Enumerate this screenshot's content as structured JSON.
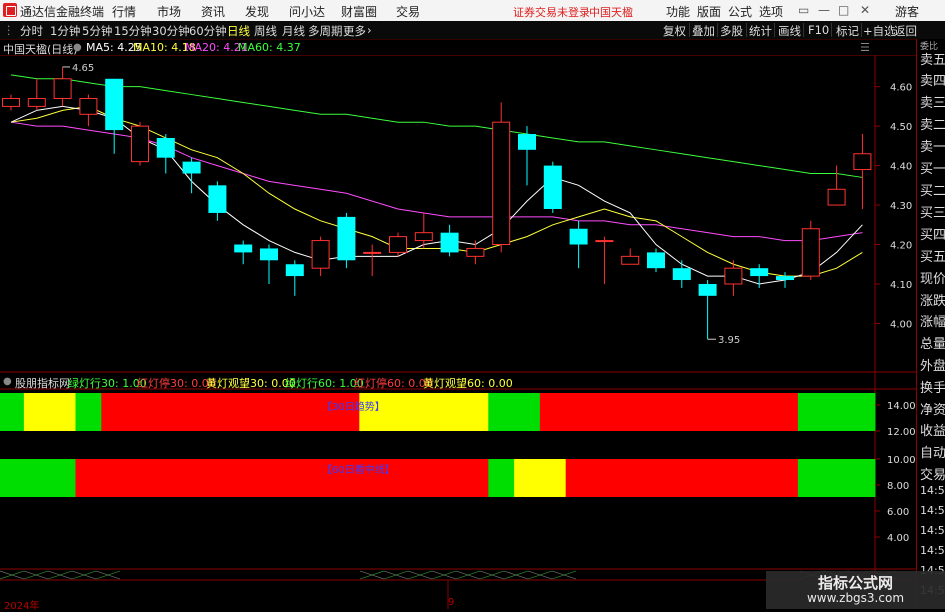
{
  "menubar": {
    "app_title": "通达信金融终端",
    "menus": [
      "行情",
      "市场",
      "资讯",
      "发现",
      "问小达",
      "财富圈",
      "交易"
    ],
    "status": "证券交易未登录",
    "stock_name": "中国天楹",
    "right_menus": [
      "功能",
      "版面",
      "公式",
      "选项"
    ],
    "window_controls": [
      "▭",
      "—",
      "□",
      "✕"
    ],
    "guest": "游客"
  },
  "toolbar": {
    "periods": [
      "分时",
      "1分钟",
      "5分钟",
      "15分钟",
      "30分钟",
      "60分钟",
      "日线",
      "周线",
      "月线",
      "多周期",
      "更多"
    ],
    "selected_period": "日线",
    "more_arrow": "›",
    "buttons": [
      "复权",
      "叠加",
      "多股",
      "统计",
      "画线",
      "F10",
      "标记",
      "+自选",
      "返回"
    ]
  },
  "main_chart": {
    "title": "中国天楹(日线)",
    "ma_labels": [
      {
        "text": "MA5: 4.25",
        "color": "#ffffff"
      },
      {
        "text": "MA10: 4.18",
        "color": "#ffff3c"
      },
      {
        "text": "MA20: 4.21",
        "color": "#ff4cff"
      },
      {
        "text": "MA60: 4.37",
        "color": "#3cff3c"
      }
    ],
    "high_label": "4.65",
    "low_label": "3.95",
    "menu_icon": "☰",
    "price_ticks": [
      "4.60",
      "4.50",
      "4.40",
      "4.30",
      "4.20",
      "4.10",
      "4.00"
    ]
  },
  "indicator": {
    "title": "股朋指标网",
    "legend": [
      {
        "text": "绿灯行30: 1.00",
        "color": "#3cff3c"
      },
      {
        "text": "红灯停30: 0.00",
        "color": "#ff3c3c"
      },
      {
        "text": "黄灯观望30: 0.00",
        "color": "#ffff3c"
      },
      {
        "text": "绿灯行60: 1.00",
        "color": "#3cff3c"
      },
      {
        "text": "红灯停60: 0.00",
        "color": "#ff3c3c"
      },
      {
        "text": "黄灯观望60: 0.00",
        "color": "#ffff3c"
      }
    ],
    "band1_label": "【30日趋势】",
    "band2_label": "【60日看中线】",
    "y_ticks": [
      "14.00",
      "12.00",
      "10.00",
      "8.00",
      "6.00",
      "4.00"
    ]
  },
  "right_panel": {
    "top": "委比",
    "items": [
      "卖五",
      "卖四",
      "卖三",
      "卖二",
      "卖一",
      "买一",
      "买二",
      "买三",
      "买四",
      "买五",
      "现价",
      "涨跌",
      "涨幅",
      "总量",
      "外盘",
      "换手",
      "净资",
      "收益",
      "自动",
      "交易",
      "14:56",
      "14:56",
      "14:56",
      "14:56",
      "14:56",
      "14:56"
    ]
  },
  "bottom": {
    "year": "2024年",
    "month": "9"
  },
  "watermark": {
    "title": "指标公式网",
    "url": "www.zbgs3.com"
  },
  "chart_data": {
    "type": "candlestick",
    "title": "中国天楹(日线)",
    "ylim": [
      3.92,
      4.66
    ],
    "candles": [
      {
        "o": 4.55,
        "c": 4.57,
        "h": 4.58,
        "l": 4.54
      },
      {
        "o": 4.55,
        "c": 4.57,
        "h": 4.62,
        "l": 4.54
      },
      {
        "o": 4.57,
        "c": 4.62,
        "h": 4.65,
        "l": 4.55
      },
      {
        "o": 4.53,
        "c": 4.57,
        "h": 4.58,
        "l": 4.5
      },
      {
        "o": 4.62,
        "c": 4.49,
        "h": 4.62,
        "l": 4.43
      },
      {
        "o": 4.41,
        "c": 4.5,
        "h": 4.51,
        "l": 4.4
      },
      {
        "o": 4.47,
        "c": 4.42,
        "h": 4.48,
        "l": 4.38
      },
      {
        "o": 4.41,
        "c": 4.38,
        "h": 4.42,
        "l": 4.33
      },
      {
        "o": 4.35,
        "c": 4.28,
        "h": 4.36,
        "l": 4.26
      },
      {
        "o": 4.2,
        "c": 4.18,
        "h": 4.21,
        "l": 4.15
      },
      {
        "o": 4.19,
        "c": 4.16,
        "h": 4.2,
        "l": 4.1
      },
      {
        "o": 4.15,
        "c": 4.12,
        "h": 4.16,
        "l": 4.07
      },
      {
        "o": 4.14,
        "c": 4.21,
        "h": 4.22,
        "l": 4.12
      },
      {
        "o": 4.27,
        "c": 4.16,
        "h": 4.28,
        "l": 4.14
      },
      {
        "o": 4.18,
        "c": 4.18,
        "h": 4.2,
        "l": 4.12
      },
      {
        "o": 4.18,
        "c": 4.22,
        "h": 4.23,
        "l": 4.17
      },
      {
        "o": 4.21,
        "c": 4.23,
        "h": 4.28,
        "l": 4.19
      },
      {
        "o": 4.23,
        "c": 4.18,
        "h": 4.25,
        "l": 4.17
      },
      {
        "o": 4.17,
        "c": 4.19,
        "h": 4.21,
        "l": 4.15
      },
      {
        "o": 4.2,
        "c": 4.51,
        "h": 4.56,
        "l": 4.18
      },
      {
        "o": 4.48,
        "c": 4.44,
        "h": 4.5,
        "l": 4.35
      },
      {
        "o": 4.4,
        "c": 4.29,
        "h": 4.41,
        "l": 4.28
      },
      {
        "o": 4.24,
        "c": 4.2,
        "h": 4.26,
        "l": 4.14
      },
      {
        "o": 4.21,
        "c": 4.21,
        "h": 4.22,
        "l": 4.1
      },
      {
        "o": 4.15,
        "c": 4.17,
        "h": 4.19,
        "l": 4.15
      },
      {
        "o": 4.18,
        "c": 4.14,
        "h": 4.19,
        "l": 4.13
      },
      {
        "o": 4.14,
        "c": 4.11,
        "h": 4.16,
        "l": 4.09
      },
      {
        "o": 4.1,
        "c": 4.07,
        "h": 4.11,
        "l": 3.96
      },
      {
        "o": 4.1,
        "c": 4.14,
        "h": 4.16,
        "l": 4.07
      },
      {
        "o": 4.14,
        "c": 4.12,
        "h": 4.15,
        "l": 4.09
      },
      {
        "o": 4.12,
        "c": 4.11,
        "h": 4.13,
        "l": 4.09
      },
      {
        "o": 4.12,
        "c": 4.24,
        "h": 4.26,
        "l": 4.11
      },
      {
        "o": 4.3,
        "c": 4.34,
        "h": 4.4,
        "l": 4.3
      },
      {
        "o": 4.39,
        "c": 4.43,
        "h": 4.48,
        "l": 4.29
      }
    ],
    "ma5": [
      4.51,
      4.54,
      4.55,
      4.54,
      4.52,
      4.47,
      4.44,
      4.36,
      4.3,
      4.25,
      4.21,
      4.18,
      4.16,
      4.17,
      4.17,
      4.17,
      4.2,
      4.21,
      4.2,
      4.24,
      4.31,
      4.37,
      4.35,
      4.31,
      4.28,
      4.2,
      4.15,
      4.12,
      4.12,
      4.1,
      4.11,
      4.13,
      4.18,
      4.25
    ],
    "ma10": [
      4.51,
      4.52,
      4.54,
      4.55,
      4.52,
      4.5,
      4.47,
      4.44,
      4.42,
      4.38,
      4.33,
      4.29,
      4.26,
      4.24,
      4.22,
      4.19,
      4.19,
      4.19,
      4.18,
      4.2,
      4.22,
      4.25,
      4.27,
      4.29,
      4.27,
      4.26,
      4.22,
      4.18,
      4.15,
      4.13,
      4.12,
      4.12,
      4.14,
      4.18
    ],
    "ma20": [
      4.51,
      4.5,
      4.5,
      4.49,
      4.48,
      4.47,
      4.45,
      4.42,
      4.4,
      4.38,
      4.36,
      4.35,
      4.34,
      4.33,
      4.31,
      4.29,
      4.28,
      4.27,
      4.27,
      4.27,
      4.27,
      4.27,
      4.26,
      4.26,
      4.25,
      4.25,
      4.24,
      4.23,
      4.22,
      4.22,
      4.21,
      4.21,
      4.22,
      4.23
    ],
    "ma60": [
      4.63,
      4.62,
      4.62,
      4.61,
      4.6,
      4.6,
      4.59,
      4.58,
      4.57,
      4.56,
      4.55,
      4.54,
      4.53,
      4.53,
      4.52,
      4.51,
      4.51,
      4.5,
      4.5,
      4.49,
      4.48,
      4.47,
      4.46,
      4.46,
      4.45,
      4.44,
      4.43,
      4.42,
      4.41,
      4.4,
      4.39,
      4.38,
      4.38,
      4.37
    ],
    "signals_30": [
      "green",
      "yellow",
      "yellow",
      "green",
      "red",
      "red",
      "red",
      "red",
      "red",
      "red",
      "red",
      "red",
      "red",
      "red",
      "yellow",
      "yellow",
      "yellow",
      "yellow",
      "yellow",
      "green",
      "green",
      "red",
      "red",
      "red",
      "red",
      "red",
      "red",
      "red",
      "red",
      "red",
      "red",
      "green",
      "green",
      "green"
    ],
    "signals_60": [
      "green",
      "green",
      "green",
      "red",
      "red",
      "red",
      "red",
      "red",
      "red",
      "red",
      "red",
      "red",
      "red",
      "red",
      "red",
      "red",
      "red",
      "red",
      "red",
      "green",
      "yellow",
      "yellow",
      "red",
      "red",
      "red",
      "red",
      "red",
      "red",
      "red",
      "red",
      "red",
      "green",
      "green",
      "green"
    ],
    "colors": {
      "up": "#ff3232",
      "down": "#00ffff",
      "green": "#00dd00",
      "yellow": "#ffff00",
      "red": "#ff0000",
      "ma5": "#ffffff",
      "ma10": "#ffff3c",
      "ma20": "#ff4cff",
      "ma60": "#3cff3c",
      "grid": "#8b0000"
    }
  }
}
